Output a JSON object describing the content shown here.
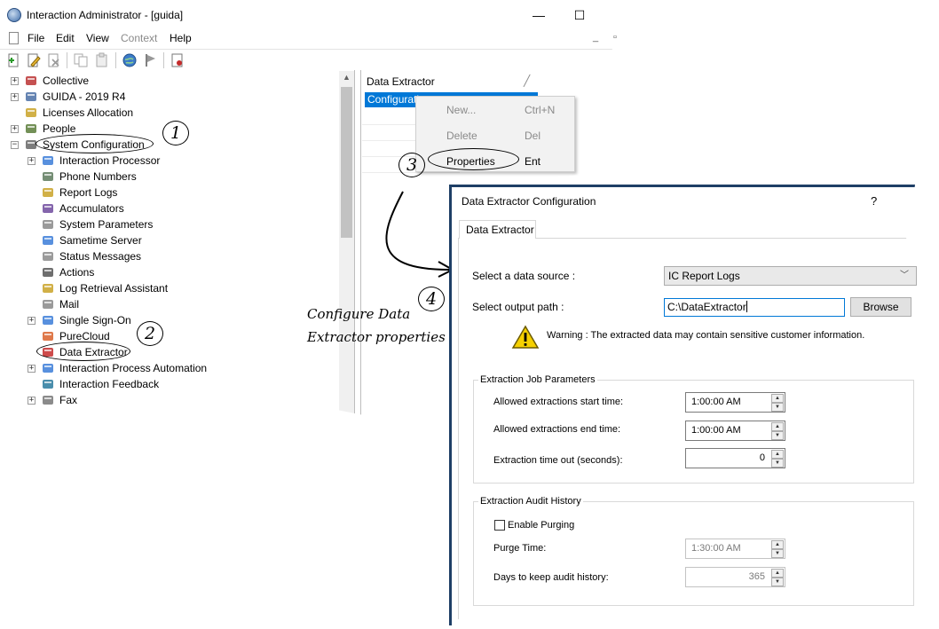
{
  "window": {
    "title": "Interaction Administrator - [guida]",
    "minimize_label": "—",
    "maximize_label": "☐",
    "mdi_minimize_label": "_",
    "mdi_restore_label": "▫"
  },
  "menu": {
    "items": [
      "File",
      "Edit",
      "View",
      "Context",
      "Help"
    ],
    "disabled": [
      "Context"
    ]
  },
  "toolbar": {
    "icons": [
      "new-icon",
      "edit-icon",
      "delete-icon",
      "copy-icon",
      "paste-icon",
      "globe-icon",
      "flag-icon",
      "report-icon"
    ]
  },
  "tree": {
    "items": [
      {
        "label": "Collective",
        "icon": "collective-icon",
        "expander": "+"
      },
      {
        "label": "GUIDA - 2019 R4",
        "icon": "server-icon",
        "expander": "+"
      },
      {
        "label": "Licenses Allocation",
        "icon": "license-icon",
        "expander": ""
      },
      {
        "label": "People",
        "icon": "people-icon",
        "expander": "+"
      },
      {
        "label": "System Configuration",
        "icon": "system-config-icon",
        "expander": "−"
      },
      {
        "label": "Interaction Processor",
        "icon": "processor-icon",
        "expander": "+"
      },
      {
        "label": "Phone Numbers",
        "icon": "phone-icon",
        "expander": ""
      },
      {
        "label": "Report Logs",
        "icon": "report-logs-icon",
        "expander": ""
      },
      {
        "label": "Accumulators",
        "icon": "accumulators-icon",
        "expander": ""
      },
      {
        "label": "System Parameters",
        "icon": "parameters-icon",
        "expander": ""
      },
      {
        "label": "Sametime Server",
        "icon": "sametime-icon",
        "expander": ""
      },
      {
        "label": "Status Messages",
        "icon": "status-messages-icon",
        "expander": ""
      },
      {
        "label": "Actions",
        "icon": "actions-icon",
        "expander": ""
      },
      {
        "label": "Log Retrieval Assistant",
        "icon": "log-retrieval-icon",
        "expander": ""
      },
      {
        "label": "Mail",
        "icon": "mail-icon",
        "expander": ""
      },
      {
        "label": "Single Sign-On",
        "icon": "sso-icon",
        "expander": "+"
      },
      {
        "label": "PureCloud",
        "icon": "purecloud-icon",
        "expander": ""
      },
      {
        "label": "Data Extractor",
        "icon": "data-extractor-icon",
        "expander": ""
      },
      {
        "label": "Interaction Process Automation",
        "icon": "process-automation-icon",
        "expander": "+"
      },
      {
        "label": "Interaction Feedback",
        "icon": "feedback-icon",
        "expander": ""
      },
      {
        "label": "Fax",
        "icon": "fax-icon",
        "expander": "+"
      }
    ]
  },
  "list": {
    "header": "Data Extractor",
    "selected_row": "Configuration"
  },
  "context_menu": {
    "items": [
      {
        "label": "New...",
        "shortcut": "Ctrl+N",
        "disabled": true
      },
      {
        "label": "Delete",
        "shortcut": "Del",
        "disabled": true
      },
      {
        "label": "Properties",
        "shortcut": "Ent",
        "disabled": false
      }
    ]
  },
  "annotations": {
    "steps": [
      "1",
      "2",
      "3",
      "4"
    ],
    "note_line1": "Configure Data",
    "note_line2": "Extractor properties"
  },
  "dialog": {
    "title": "Data Extractor Configuration",
    "help": "?",
    "tab": "Data Extractor",
    "data_source_label": "Select a data source :",
    "data_source_value": "IC Report Logs",
    "output_path_label": "Select output path :",
    "output_path_value": "C:\\DataExtractor",
    "browse_label": "Browse",
    "warning_text": "Warning : The extracted data may contain sensitive customer information.",
    "job_group_title": "Extraction Job Parameters",
    "start_time_label": "Allowed extractions start time:",
    "start_time_value": "1:00:00 AM",
    "end_time_label": "Allowed extractions end time:",
    "end_time_value": "1:00:00 AM",
    "timeout_label": "Extraction time out (seconds):",
    "timeout_value": "0",
    "audit_group_title": "Extraction Audit History",
    "purging_label": "Enable Purging",
    "purging_checked": false,
    "purge_time_label": "Purge Time:",
    "purge_time_value": "1:30:00 AM",
    "days_label": "Days to keep audit history:",
    "days_value": "365"
  },
  "colors": {
    "selection": "#0078d7",
    "dialog_border": "#1e3f66",
    "warning": "#f5d000"
  }
}
